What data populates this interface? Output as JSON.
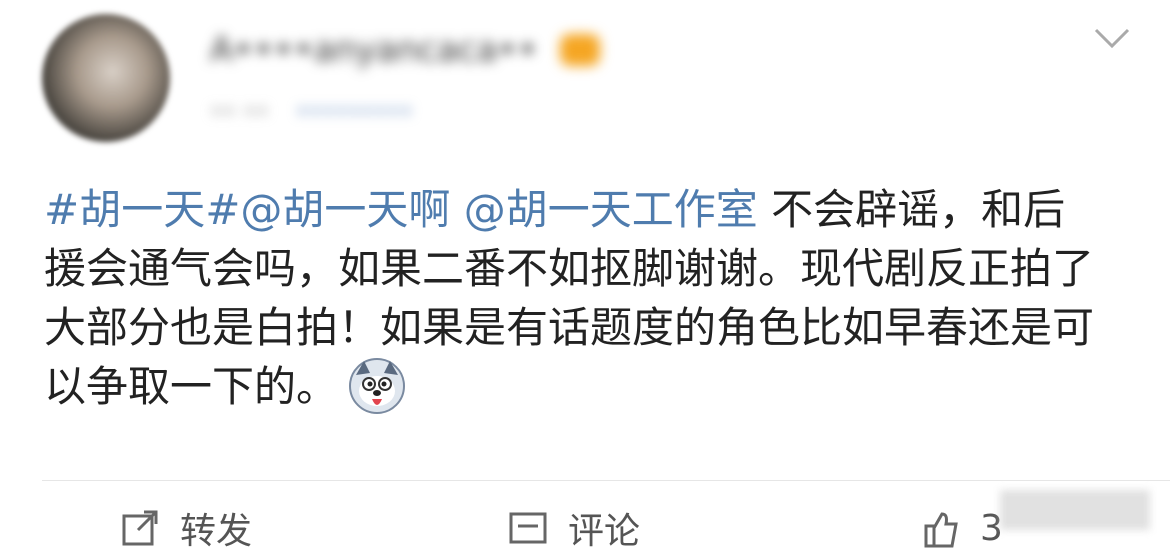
{
  "post": {
    "username": "A••••anyancaca••",
    "meta_time": "•• ••",
    "meta_source": "•••••••••",
    "text_segments": [
      {
        "text": "#胡一天#@胡一天啊 @胡一天工作室",
        "type": "link"
      },
      {
        "text": " 不会辟谣，和后援会通气会吗，如果二番不如抠脚谢谢。现代剧反正拍了大部分也是白拍！如果是有话题度的角色比如早春还是可以争取一下的。",
        "type": "text"
      }
    ],
    "emoji": "husky-tongue-emoji"
  },
  "actions": {
    "repost_label": "转发",
    "comment_label": "评论",
    "like_count": "3"
  },
  "colors": {
    "link": "#4f7cae",
    "text": "#222222",
    "muted": "#999999"
  },
  "icons": [
    "chevron-down-icon",
    "repost-icon",
    "comment-icon",
    "like-icon"
  ]
}
